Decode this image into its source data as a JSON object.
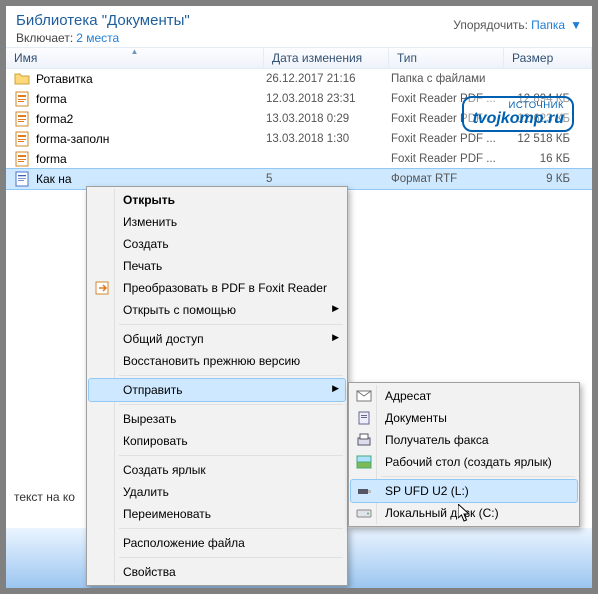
{
  "header": {
    "library_title": "Библиотека \"Документы\"",
    "includes_label": "Включает:",
    "includes_link": "2 места",
    "arrange_label": "Упорядочить:",
    "arrange_value": "Папка"
  },
  "columns": {
    "name": "Имя",
    "date": "Дата изменения",
    "type": "Тип",
    "size": "Размер"
  },
  "files": [
    {
      "icon": "folder",
      "name": "Ротавитка",
      "date": "26.12.2017 21:16",
      "type": "Папка с файлами",
      "size": ""
    },
    {
      "icon": "foxit",
      "name": "forma",
      "date": "12.03.2018 23:31",
      "type": "Foxit Reader PDF ...",
      "size": "12 894 КБ"
    },
    {
      "icon": "foxit",
      "name": "forma2",
      "date": "13.03.2018 0:29",
      "type": "Foxit Reader PDF ...",
      "size": "12 623 КБ"
    },
    {
      "icon": "foxit",
      "name": "forma-заполн",
      "date": "13.03.2018 1:30",
      "type": "Foxit Reader PDF ...",
      "size": "12 518 КБ"
    },
    {
      "icon": "foxit",
      "name": "forma",
      "date": "",
      "type": "Foxit Reader PDF ...",
      "size": "16 КБ"
    },
    {
      "icon": "rtf",
      "name": "Как на",
      "date": "5",
      "type": "Формат RTF",
      "size": "9 КБ",
      "selected": true
    }
  ],
  "ctx_menu": [
    {
      "label": "Открыть",
      "bold": true
    },
    {
      "label": "Изменить"
    },
    {
      "label": "Создать"
    },
    {
      "label": "Печать"
    },
    {
      "label": "Преобразовать в PDF в Foxit Reader",
      "icon": "foxit-convert"
    },
    {
      "label": "Открыть с помощью",
      "submenu": true
    },
    {
      "sep": true
    },
    {
      "label": "Общий доступ",
      "submenu": true
    },
    {
      "label": "Восстановить прежнюю версию"
    },
    {
      "sep": true
    },
    {
      "label": "Отправить",
      "submenu": true,
      "hover": true
    },
    {
      "sep": true
    },
    {
      "label": "Вырезать"
    },
    {
      "label": "Копировать"
    },
    {
      "sep": true
    },
    {
      "label": "Создать ярлык"
    },
    {
      "label": "Удалить"
    },
    {
      "label": "Переименовать"
    },
    {
      "sep": true
    },
    {
      "label": "Расположение файла"
    },
    {
      "sep": true
    },
    {
      "label": "Свойства"
    }
  ],
  "send_to_menu": [
    {
      "label": "Адресат",
      "icon": "mail"
    },
    {
      "label": "Документы",
      "icon": "docs"
    },
    {
      "label": "Получатель факса",
      "icon": "fax"
    },
    {
      "label": "Рабочий стол (создать ярлык)",
      "icon": "desktop"
    },
    {
      "sep": true
    },
    {
      "label": "SP UFD U2 (L:)",
      "icon": "usb",
      "hover": true
    },
    {
      "label": "Локальный диск (C:)",
      "icon": "disk"
    }
  ],
  "tip_fragment": "текст на ко",
  "watermark": {
    "line1": "ИСТОЧНИК",
    "line2": "tvojkomp.ru"
  }
}
